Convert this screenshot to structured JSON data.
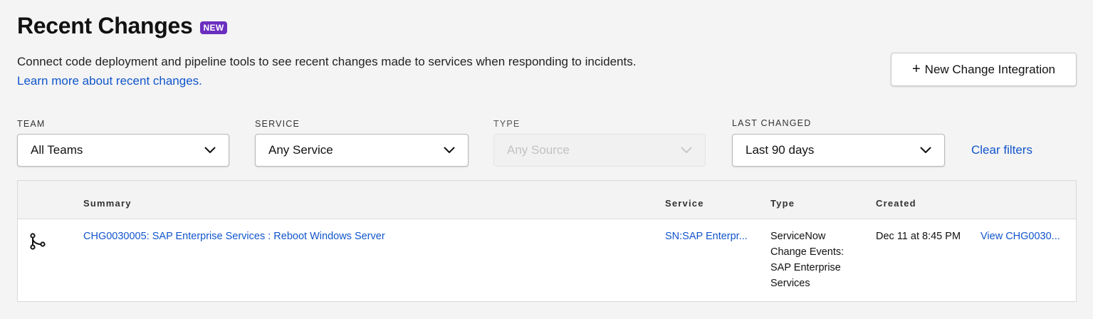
{
  "header": {
    "title": "Recent Changes",
    "badge": "NEW",
    "description": "Connect code deployment and pipeline tools to see recent changes made to services when responding to incidents.",
    "learn_more": "Learn more about recent changes."
  },
  "actions": {
    "new_integration_plus": "+",
    "new_integration_label": "New Change Integration"
  },
  "filters": {
    "team": {
      "label": "TEAM",
      "value": "All Teams"
    },
    "service": {
      "label": "SERVICE",
      "value": "Any Service"
    },
    "type": {
      "label": "TYPE",
      "value": "Any Source",
      "disabled": true
    },
    "last_changed": {
      "label": "LAST CHANGED",
      "value": "Last 90 days"
    },
    "clear": "Clear filters"
  },
  "table": {
    "columns": {
      "summary": "Summary",
      "service": "Service",
      "type": "Type",
      "created": "Created"
    },
    "rows": [
      {
        "icon": "git-branch-icon",
        "summary": "CHG0030005: SAP Enterprise Services : Reboot Windows Server",
        "service": "SN:SAP Enterpr...",
        "type_lines": [
          "ServiceNow",
          "Change Events:",
          "SAP Enterprise",
          "Services"
        ],
        "created": "Dec 11 at 8:45 PM",
        "view": "View CHG0030..."
      }
    ]
  },
  "colors": {
    "accent_link": "#1155cc",
    "badge": "#6b2fbf",
    "background": "#f4f4f4"
  }
}
